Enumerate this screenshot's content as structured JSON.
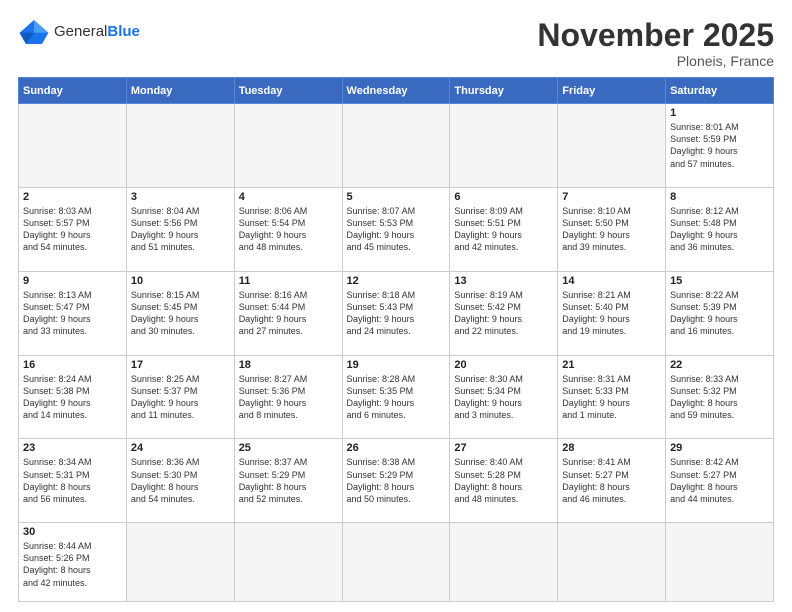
{
  "header": {
    "logo_general": "General",
    "logo_blue": "Blue",
    "month_title": "November 2025",
    "location": "Ploneis, France"
  },
  "weekdays": [
    "Sunday",
    "Monday",
    "Tuesday",
    "Wednesday",
    "Thursday",
    "Friday",
    "Saturday"
  ],
  "days": [
    {
      "num": "",
      "info": "",
      "empty": true
    },
    {
      "num": "",
      "info": "",
      "empty": true
    },
    {
      "num": "",
      "info": "",
      "empty": true
    },
    {
      "num": "",
      "info": "",
      "empty": true
    },
    {
      "num": "",
      "info": "",
      "empty": true
    },
    {
      "num": "",
      "info": "",
      "empty": true
    },
    {
      "num": "1",
      "info": "Sunrise: 8:01 AM\nSunset: 5:59 PM\nDaylight: 9 hours\nand 57 minutes."
    },
    {
      "num": "2",
      "info": "Sunrise: 8:03 AM\nSunset: 5:57 PM\nDaylight: 9 hours\nand 54 minutes."
    },
    {
      "num": "3",
      "info": "Sunrise: 8:04 AM\nSunset: 5:56 PM\nDaylight: 9 hours\nand 51 minutes."
    },
    {
      "num": "4",
      "info": "Sunrise: 8:06 AM\nSunset: 5:54 PM\nDaylight: 9 hours\nand 48 minutes."
    },
    {
      "num": "5",
      "info": "Sunrise: 8:07 AM\nSunset: 5:53 PM\nDaylight: 9 hours\nand 45 minutes."
    },
    {
      "num": "6",
      "info": "Sunrise: 8:09 AM\nSunset: 5:51 PM\nDaylight: 9 hours\nand 42 minutes."
    },
    {
      "num": "7",
      "info": "Sunrise: 8:10 AM\nSunset: 5:50 PM\nDaylight: 9 hours\nand 39 minutes."
    },
    {
      "num": "8",
      "info": "Sunrise: 8:12 AM\nSunset: 5:48 PM\nDaylight: 9 hours\nand 36 minutes."
    },
    {
      "num": "9",
      "info": "Sunrise: 8:13 AM\nSunset: 5:47 PM\nDaylight: 9 hours\nand 33 minutes."
    },
    {
      "num": "10",
      "info": "Sunrise: 8:15 AM\nSunset: 5:45 PM\nDaylight: 9 hours\nand 30 minutes."
    },
    {
      "num": "11",
      "info": "Sunrise: 8:16 AM\nSunset: 5:44 PM\nDaylight: 9 hours\nand 27 minutes."
    },
    {
      "num": "12",
      "info": "Sunrise: 8:18 AM\nSunset: 5:43 PM\nDaylight: 9 hours\nand 24 minutes."
    },
    {
      "num": "13",
      "info": "Sunrise: 8:19 AM\nSunset: 5:42 PM\nDaylight: 9 hours\nand 22 minutes."
    },
    {
      "num": "14",
      "info": "Sunrise: 8:21 AM\nSunset: 5:40 PM\nDaylight: 9 hours\nand 19 minutes."
    },
    {
      "num": "15",
      "info": "Sunrise: 8:22 AM\nSunset: 5:39 PM\nDaylight: 9 hours\nand 16 minutes."
    },
    {
      "num": "16",
      "info": "Sunrise: 8:24 AM\nSunset: 5:38 PM\nDaylight: 9 hours\nand 14 minutes."
    },
    {
      "num": "17",
      "info": "Sunrise: 8:25 AM\nSunset: 5:37 PM\nDaylight: 9 hours\nand 11 minutes."
    },
    {
      "num": "18",
      "info": "Sunrise: 8:27 AM\nSunset: 5:36 PM\nDaylight: 9 hours\nand 8 minutes."
    },
    {
      "num": "19",
      "info": "Sunrise: 8:28 AM\nSunset: 5:35 PM\nDaylight: 9 hours\nand 6 minutes."
    },
    {
      "num": "20",
      "info": "Sunrise: 8:30 AM\nSunset: 5:34 PM\nDaylight: 9 hours\nand 3 minutes."
    },
    {
      "num": "21",
      "info": "Sunrise: 8:31 AM\nSunset: 5:33 PM\nDaylight: 9 hours\nand 1 minute."
    },
    {
      "num": "22",
      "info": "Sunrise: 8:33 AM\nSunset: 5:32 PM\nDaylight: 8 hours\nand 59 minutes."
    },
    {
      "num": "23",
      "info": "Sunrise: 8:34 AM\nSunset: 5:31 PM\nDaylight: 8 hours\nand 56 minutes."
    },
    {
      "num": "24",
      "info": "Sunrise: 8:36 AM\nSunset: 5:30 PM\nDaylight: 8 hours\nand 54 minutes."
    },
    {
      "num": "25",
      "info": "Sunrise: 8:37 AM\nSunset: 5:29 PM\nDaylight: 8 hours\nand 52 minutes."
    },
    {
      "num": "26",
      "info": "Sunrise: 8:38 AM\nSunset: 5:29 PM\nDaylight: 8 hours\nand 50 minutes."
    },
    {
      "num": "27",
      "info": "Sunrise: 8:40 AM\nSunset: 5:28 PM\nDaylight: 8 hours\nand 48 minutes."
    },
    {
      "num": "28",
      "info": "Sunrise: 8:41 AM\nSunset: 5:27 PM\nDaylight: 8 hours\nand 46 minutes."
    },
    {
      "num": "29",
      "info": "Sunrise: 8:42 AM\nSunset: 5:27 PM\nDaylight: 8 hours\nand 44 minutes."
    },
    {
      "num": "30",
      "info": "Sunrise: 8:44 AM\nSunset: 5:26 PM\nDaylight: 8 hours\nand 42 minutes."
    },
    {
      "num": "",
      "info": "",
      "empty": true
    },
    {
      "num": "",
      "info": "",
      "empty": true
    },
    {
      "num": "",
      "info": "",
      "empty": true
    },
    {
      "num": "",
      "info": "",
      "empty": true
    },
    {
      "num": "",
      "info": "",
      "empty": true
    },
    {
      "num": "",
      "info": "",
      "empty": true
    }
  ]
}
